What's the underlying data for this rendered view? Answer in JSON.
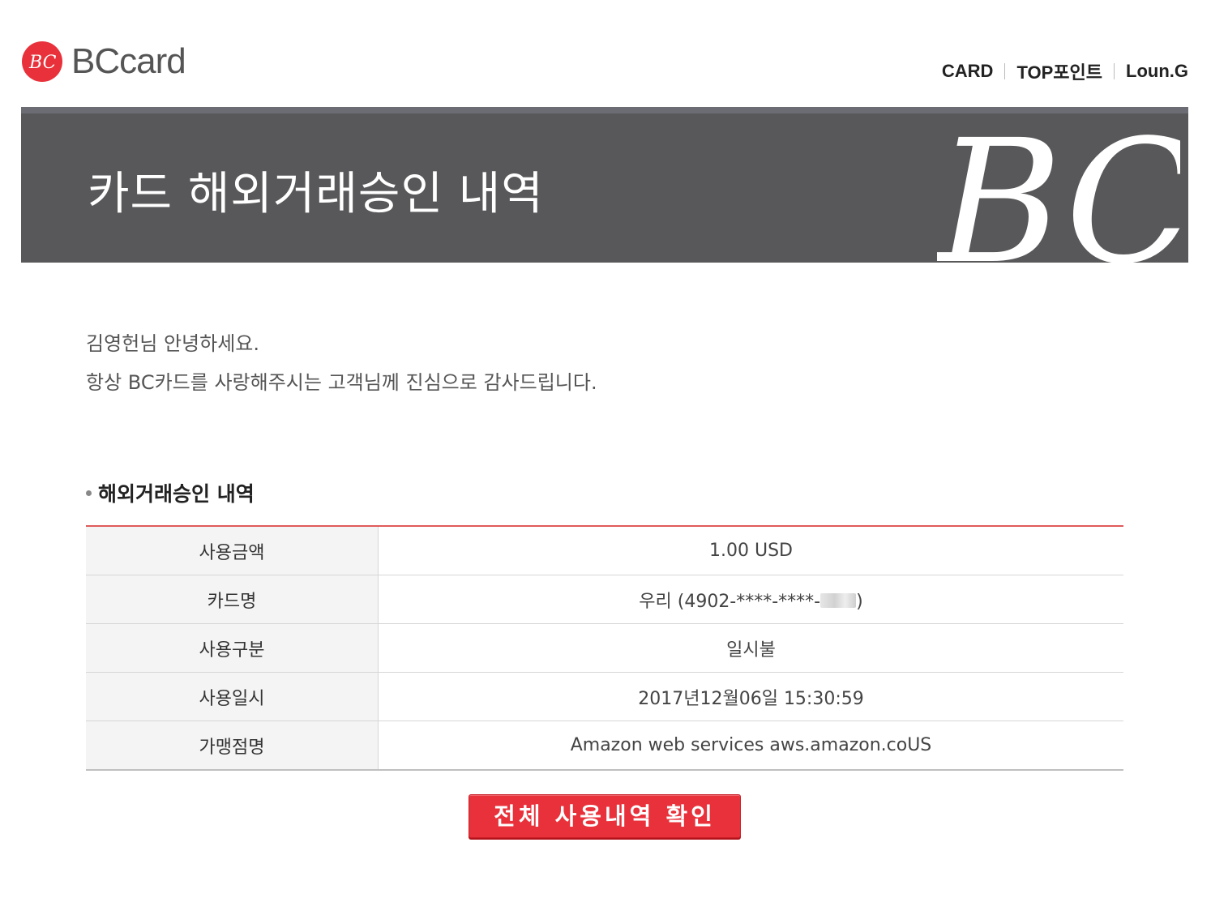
{
  "header": {
    "logo_text": "BCcard",
    "logo_mark_text": "BC",
    "nav": [
      {
        "label": "CARD"
      },
      {
        "label": "TOP포인트"
      },
      {
        "label": "Loun.G"
      }
    ]
  },
  "banner": {
    "title": "카드 해외거래승인 내역",
    "watermark": "BC"
  },
  "greeting": {
    "line1": "김영헌님 안녕하세요.",
    "line2": "항상 BC카드를 사랑해주시는 고객님께 진심으로 감사드립니다."
  },
  "section": {
    "title": "해외거래승인 내역",
    "rows": [
      {
        "label": "사용금액",
        "value": "1.00 USD"
      },
      {
        "label": "카드명",
        "value_prefix": "우리 (4902-****-****-",
        "value_suffix": ")"
      },
      {
        "label": "사용구분",
        "value": "일시불"
      },
      {
        "label": "사용일시",
        "value": "2017년12월06일 15:30:59"
      },
      {
        "label": "가맹점명",
        "value": "Amazon web services aws.amazon.coUS"
      }
    ]
  },
  "button": {
    "label": "전체 사용내역 확인"
  },
  "colors": {
    "brand_red": "#e8313a",
    "banner_gray": "#58585a",
    "table_top_border": "#e05a5a"
  }
}
